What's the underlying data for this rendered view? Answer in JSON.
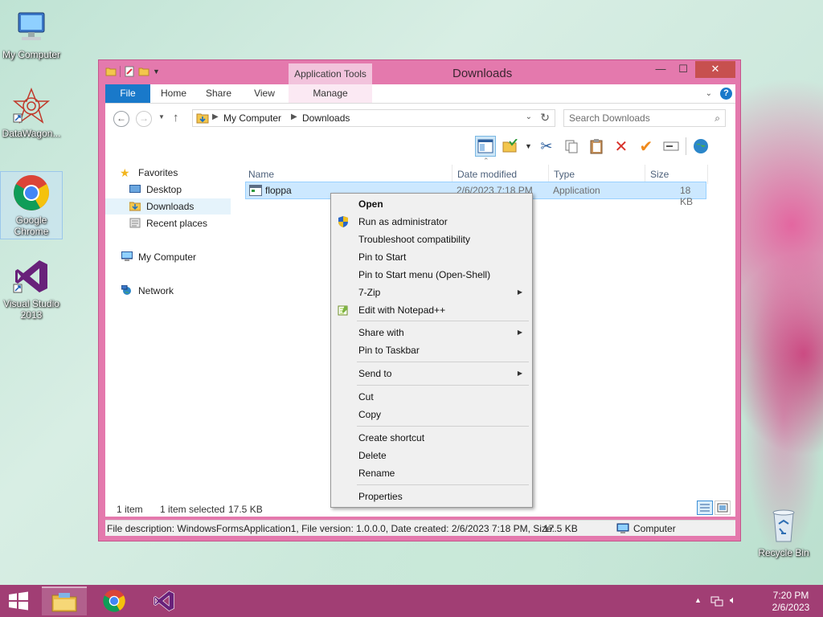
{
  "desktop": {
    "icons": [
      {
        "label": "My Computer"
      },
      {
        "label": "DataWagon..."
      },
      {
        "label": "Google Chrome"
      },
      {
        "label": "Visual Studio 2013"
      },
      {
        "label": "Recycle Bin"
      }
    ]
  },
  "window": {
    "title": "Downloads",
    "context_tab_header": "Application Tools",
    "tabs": {
      "file": "File",
      "home": "Home",
      "share": "Share",
      "view": "View",
      "manage": "Manage"
    },
    "address": {
      "crumbs": [
        "My Computer",
        "Downloads"
      ]
    },
    "search": {
      "placeholder": "Search Downloads"
    },
    "nav": {
      "favorites": "Favorites",
      "desktop": "Desktop",
      "downloads": "Downloads",
      "recent": "Recent places",
      "my_computer": "My Computer",
      "network": "Network"
    },
    "columns": {
      "name": "Name",
      "date": "Date modified",
      "type": "Type",
      "size": "Size"
    },
    "files": [
      {
        "name": "floppa",
        "date": "2/6/2023 7:18 PM",
        "type": "Application",
        "size": "18 KB"
      }
    ],
    "status": {
      "items": "1 item",
      "selected": "1 item selected",
      "selected_size": "17.5 KB"
    },
    "detail": {
      "text": "File description: WindowsFormsApplication1, File version: 1.0.0.0, Date created: 2/6/2023 7:18 PM, Size:",
      "size": "17.5 KB",
      "location": "Computer"
    }
  },
  "context_menu": {
    "open": "Open",
    "run_admin": "Run as administrator",
    "troubleshoot": "Troubleshoot compatibility",
    "pin_start": "Pin to Start",
    "pin_start_menu": "Pin to Start menu (Open-Shell)",
    "zip": "7-Zip",
    "notepad": "Edit with Notepad++",
    "share_with": "Share with",
    "pin_taskbar": "Pin to Taskbar",
    "send_to": "Send to",
    "cut": "Cut",
    "copy": "Copy",
    "create_shortcut": "Create shortcut",
    "delete": "Delete",
    "rename": "Rename",
    "properties": "Properties"
  },
  "taskbar": {
    "time": "7:20 PM",
    "date": "2/6/2023"
  },
  "colors": {
    "window_frame": "#e479ad",
    "taskbar": "#a13e74",
    "file_tab": "#1979ca",
    "selection": "#cce8ff"
  }
}
